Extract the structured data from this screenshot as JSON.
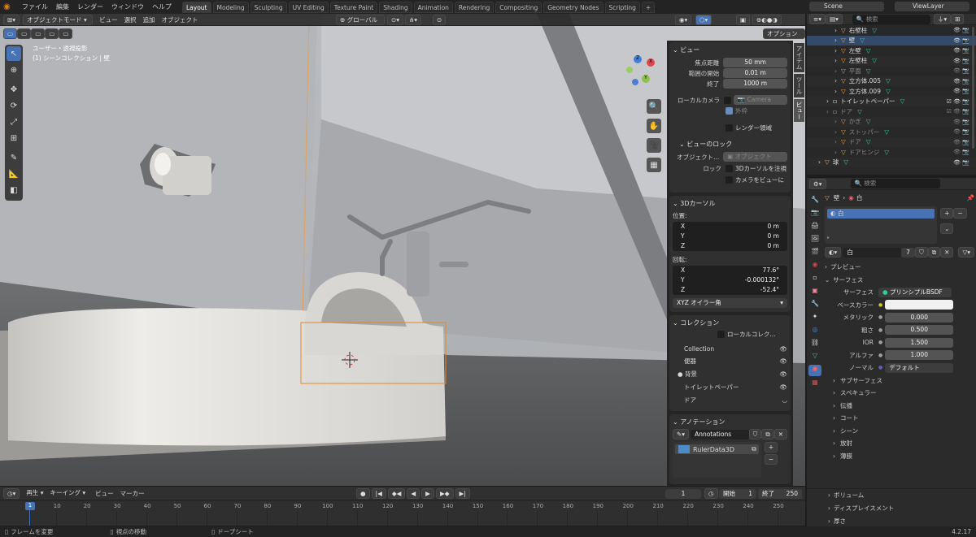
{
  "topbar": {
    "menus": [
      "ファイル",
      "編集",
      "レンダー",
      "ウィンドウ",
      "ヘルプ"
    ],
    "tabs": [
      "Layout",
      "Modeling",
      "Sculpting",
      "UV Editing",
      "Texture Paint",
      "Shading",
      "Animation",
      "Rendering",
      "Compositing",
      "Geometry Nodes",
      "Scripting"
    ],
    "active_tab": "Layout",
    "scene": "Scene",
    "view_layer": "ViewLayer"
  },
  "viewport": {
    "mode": "オブジェクトモード",
    "menus": [
      "ビュー",
      "選択",
      "追加",
      "オブジェクト"
    ],
    "transform": "グローバル",
    "view_label": "ユーザー・透視投影",
    "collection_label": "(1) シーンコレクション | 壁",
    "options": "オプション",
    "sidebar_tabs": [
      "アイテム",
      "ツール",
      "ビュー"
    ]
  },
  "npanel": {
    "view": {
      "title": "ビュー",
      "focal_label": "焦点距離",
      "focal": "50 mm",
      "clip_start_label": "範囲の開始",
      "clip_start": "0.01 m",
      "clip_end_label": "終了",
      "clip_end": "1000 m",
      "local_camera_label": "ローカルカメラ",
      "camera_placeholder": "Camera",
      "frame_label": "外枠",
      "render_region_label": "レンダー領域"
    },
    "lock": {
      "title": "ビューのロック",
      "object_label": "オブジェクト...",
      "object_placeholder": "オブジェクト",
      "lock_label": "ロック",
      "lock_cursor": "3Dカーソルを注視",
      "lock_camera": "カメラをビューに"
    },
    "cursor": {
      "title": "3Dカーソル",
      "location_label": "位置:",
      "x_label": "X",
      "y_label": "Y",
      "z_label": "Z",
      "loc_x": "0 m",
      "loc_y": "0 m",
      "loc_z": "0 m",
      "rotation_label": "回転:",
      "rot_x": "77.6°",
      "rot_y": "-0.000132°",
      "rot_z": "-52.4°",
      "rotation_mode": "XYZ オイラー角"
    },
    "collection": {
      "title": "コレクション",
      "local": "ローカルコレク...",
      "items": [
        "Collection",
        "便器",
        "背景",
        "トイレットペーパー",
        "ドア"
      ]
    },
    "annotation": {
      "title": "アノテーション",
      "name": "Annotations",
      "layer": "RulerData3D"
    }
  },
  "outliner": {
    "search_placeholder": "検索",
    "rows": [
      {
        "name": "右壁柱"
      },
      {
        "name": "壁"
      },
      {
        "name": "左壁"
      },
      {
        "name": "左壁柱"
      },
      {
        "name": "平面"
      },
      {
        "name": "立方体.005"
      },
      {
        "name": "立方体.009"
      },
      {
        "name": "トイレットペーパー"
      },
      {
        "name": "ドア"
      },
      {
        "name": "かぎ"
      },
      {
        "name": "ストッパー"
      },
      {
        "name": "ドア"
      },
      {
        "name": "ドアヒンジ"
      },
      {
        "name": "球"
      }
    ]
  },
  "properties": {
    "search_placeholder": "検索",
    "breadcrumb_object": "壁",
    "breadcrumb_material": "白",
    "slot": "白",
    "material_name": "白",
    "users": "7",
    "preview": "プレビュー",
    "surface_title": "サーフェス",
    "surface_label": "サーフェス",
    "surface_value": "プリンシプルBSDF",
    "fields": [
      {
        "label": "ベースカラー",
        "value": "",
        "kind": "color"
      },
      {
        "label": "メタリック",
        "value": "0.000",
        "kind": "num"
      },
      {
        "label": "粗さ",
        "value": "0.500",
        "kind": "num"
      },
      {
        "label": "IOR",
        "value": "1.500",
        "kind": "num"
      },
      {
        "label": "アルファ",
        "value": "1.000",
        "kind": "num"
      },
      {
        "label": "ノーマル",
        "value": "デフォルト",
        "kind": "link"
      }
    ],
    "subsections": [
      "サブサーフェス",
      "スペキュラー",
      "伝播",
      "コート",
      "シーン",
      "放射",
      "薄膜"
    ],
    "volume": "ボリューム",
    "displacement": "ディスプレイスメント",
    "thickness": "厚さ"
  },
  "timeline": {
    "playback": "再生",
    "keying": "キーイング",
    "view": "ビュー",
    "marker": "マーカー",
    "current_frame": "1",
    "start_label": "開始",
    "start": "1",
    "end_label": "終了",
    "end": "250",
    "ticks": [
      "1",
      "10",
      "20",
      "30",
      "40",
      "50",
      "60",
      "70",
      "80",
      "90",
      "100",
      "110",
      "120",
      "130",
      "140",
      "150",
      "160",
      "170",
      "180",
      "190",
      "200",
      "210",
      "220",
      "230",
      "240",
      "250"
    ]
  },
  "statusbar": {
    "left": "フレームを変更",
    "middle": "視点の移動",
    "right": "ドープシート",
    "version": "4.2.17"
  }
}
